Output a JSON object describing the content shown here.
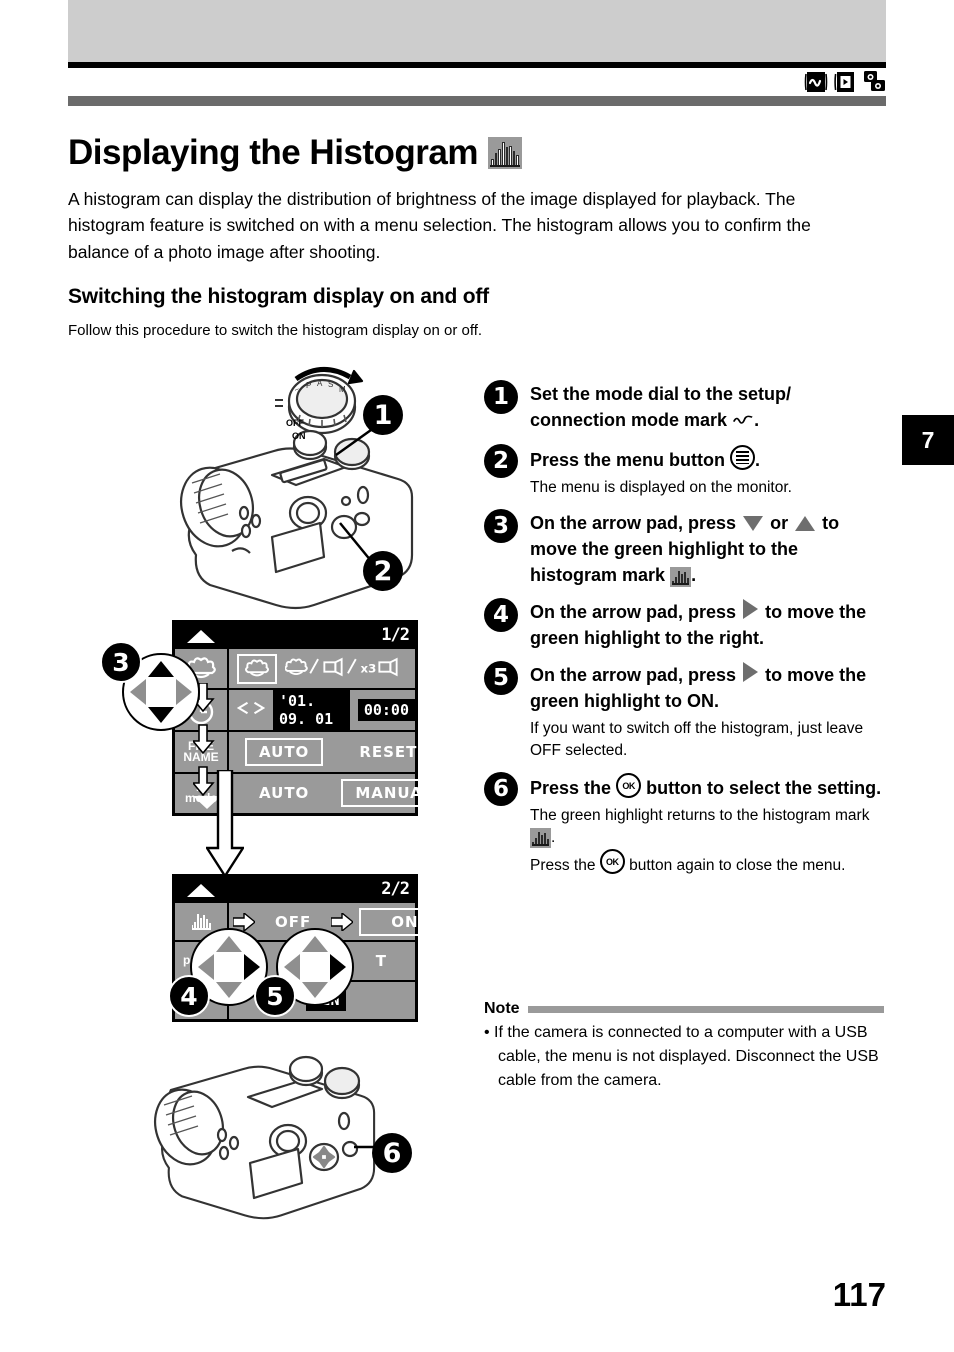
{
  "header": {
    "mode_icons": [
      "setup-connection-mode-icon",
      "playback-mode-icon",
      "dual-camera-mode-icon"
    ]
  },
  "title": "Displaying the Histogram",
  "title_icon": "histogram-icon",
  "intro": "A histogram can display the distribution of brightness of the image displayed for playback. The histogram feature is switched on with a menu selection. The histogram allows you to confirm the balance of a photo image after shooting.",
  "subhead": "Switching the histogram display on and off",
  "subcopy": "Follow this procedure to switch the histogram display on or off.",
  "chapter_tab": "7",
  "page_number": "117",
  "steps": [
    {
      "number": "1",
      "main_a": "Set the mode dial to the setup/",
      "main_b": "connection mode mark",
      "main_c": ".",
      "icon": "connection-mode-mark-icon",
      "sub": ""
    },
    {
      "number": "2",
      "main_a": "Press the menu button",
      "main_c": ".",
      "icon": "menu-button-icon",
      "sub": "The menu is displayed on the monitor."
    },
    {
      "number": "3",
      "main_a": "On the arrow pad, press",
      "main_mid": "or",
      "main_b": "to move the green highlight to the",
      "main_c": "histogram mark",
      "main_d": ".",
      "sub": ""
    },
    {
      "number": "4",
      "main_a": "On the arrow pad, press",
      "main_b": "to move the green highlight to the right.",
      "sub": ""
    },
    {
      "number": "5",
      "main_a": "On the arrow pad, press",
      "main_b": "to move the green highlight to ON.",
      "sub": "If you want to switch off the histogram, just leave OFF selected."
    },
    {
      "number": "6",
      "main_a": "Press the",
      "main_b": "button to select the setting.",
      "sub_a": "The green highlight returns to the",
      "sub_b": "histogram mark",
      "sub_c": ".",
      "sub_d": "Press the",
      "sub_e": "button again to close the menu."
    }
  ],
  "note": {
    "label": "Note",
    "items": [
      "• If the camera is connected to a computer with a USB cable, the menu is not displayed. Disconnect the USB cable from the camera."
    ]
  },
  "lcd_screen_1": {
    "page_indicator": "1/2",
    "rows": [
      {
        "icon": "macro-flower-icon",
        "selected": "macro-flower-icon",
        "options": "/ / x3"
      },
      {
        "icon": "clock-icon",
        "date": "'01. 09. 01",
        "time": "00:00"
      },
      {
        "icon_line1": "FILE",
        "icon_line2": "NAME",
        "option_1": "AUTO",
        "option_2": "RESET",
        "selected": "AUTO"
      },
      {
        "icon_line1": "M",
        "icon_line2": "mode",
        "option_1": "AUTO",
        "option_2": "MANUAL",
        "selected": "MANUAL"
      }
    ]
  },
  "lcd_screen_2": {
    "page_indicator": "2/2",
    "rows": [
      {
        "icon": "histogram-icon",
        "option_1": "OFF",
        "option_2": "ON",
        "selected": "ON"
      },
      {
        "icon": "p-icon",
        "option_2": "T"
      },
      {
        "icon": "",
        "option_2": "MIN"
      }
    ]
  },
  "camera_top": {
    "dial_off": "OFF",
    "dial_on": "ON",
    "callout_1": "1",
    "callout_2": "2"
  },
  "camera_bottom": {
    "callout_6": "6"
  },
  "arrow_pad_callouts": {
    "pad_3": "3",
    "pad_4": "4",
    "pad_5": "5"
  },
  "colors": {
    "top_band": "#cdcdcd",
    "title_bar": "#6b6b6b",
    "lcd_bg": "#9a9a9a",
    "note_rule": "#9a9a9a",
    "tab": "#000000"
  }
}
